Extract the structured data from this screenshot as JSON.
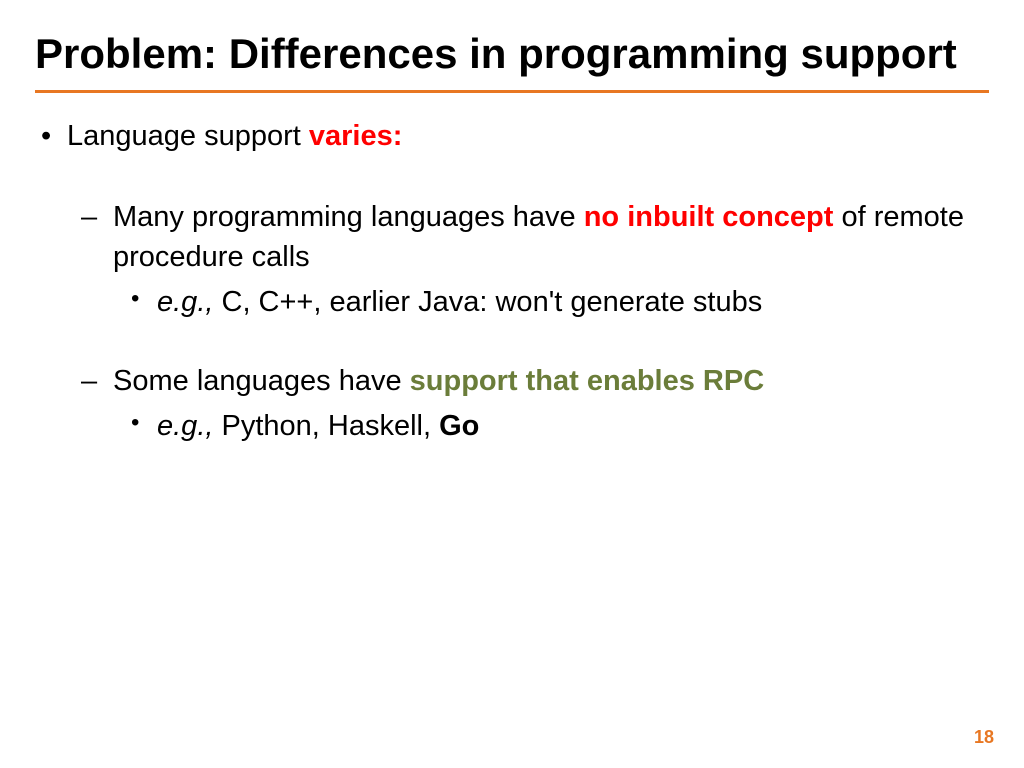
{
  "title": "Problem: Differences in programming support",
  "bullet1": {
    "prefix": "Language support ",
    "emphasis": "varies:"
  },
  "bullet2a": {
    "prefix": "Many programming languages have ",
    "emphasis": "no inbuilt concept",
    "suffix": " of remote procedure calls"
  },
  "bullet2a_sub": {
    "eg": "e.g.,",
    "text": " C, C++, earlier Java: won't generate stubs"
  },
  "bullet2b": {
    "prefix": "Some languages have ",
    "emphasis": "support that enables RPC"
  },
  "bullet2b_sub": {
    "eg": "e.g.,",
    "text": " Python, Haskell, ",
    "bold": "Go"
  },
  "page_number": "18"
}
